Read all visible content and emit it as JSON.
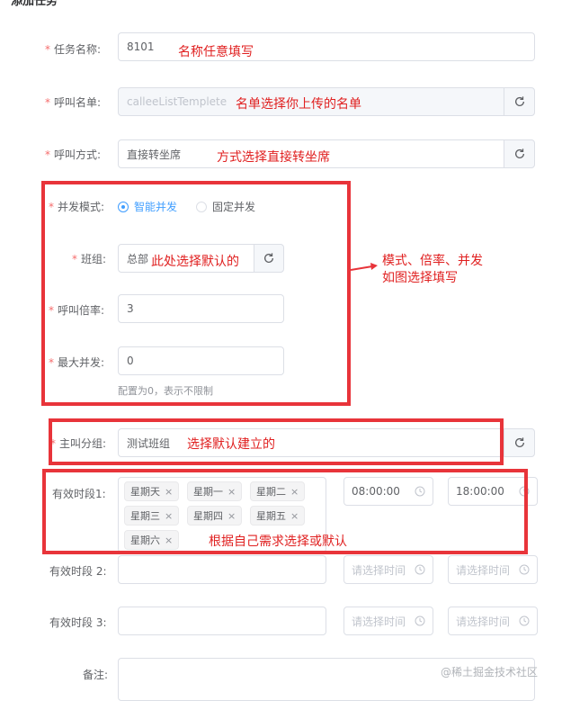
{
  "header": {
    "title": "添加任务"
  },
  "form": {
    "task_name": {
      "label": "任务名称:",
      "value": "8101",
      "note": "名称任意填写"
    },
    "call_list": {
      "label": "呼叫名单:",
      "value": "calleeListTemplete",
      "note": "名单选择你上传的名单"
    },
    "call_mode": {
      "label": "呼叫方式:",
      "value": "直接转坐席",
      "note": "方式选择直接转坐席"
    },
    "concurrency_mode": {
      "label": "并发模式:",
      "options": [
        "智能并发",
        "固定并发"
      ],
      "selected": "智能并发"
    },
    "team": {
      "label": "班组:",
      "value": "总部",
      "note": "此处选择默认的"
    },
    "call_rate": {
      "label": "呼叫倍率:",
      "value": "3"
    },
    "max_concurrency": {
      "label": "最大并发:",
      "value": "0",
      "hint": "配置为0，表示不限制"
    },
    "caller_group": {
      "label": "主叫分组:",
      "value": "测试班组",
      "note": "选择默认建立的"
    },
    "period1": {
      "label": "有效时段1:",
      "days": [
        "星期天",
        "星期一",
        "星期二",
        "星期三",
        "星期四",
        "星期五",
        "星期六"
      ],
      "start": "08:00:00",
      "end": "18:00:00",
      "note": "根据自己需求选择或默认"
    },
    "period2": {
      "label": "有效时段 2:",
      "start_placeholder": "请选择时间",
      "end_placeholder": "请选择时间"
    },
    "period3": {
      "label": "有效时段 3:",
      "start_placeholder": "请选择时间",
      "end_placeholder": "请选择时间"
    },
    "remark": {
      "label": "备注:"
    }
  },
  "side_note": {
    "line1": "模式、倍率、并发",
    "line2": "如图选择填写"
  },
  "watermark": "@稀土掘金技术社区",
  "colors": {
    "annotation_red": "#e8343a",
    "primary": "#409eff",
    "required": "#f56c6c"
  }
}
